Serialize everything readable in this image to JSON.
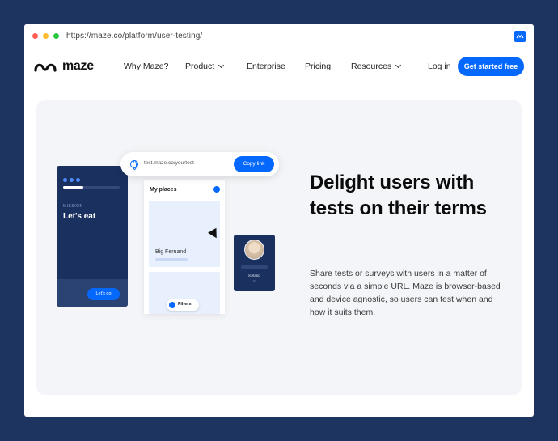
{
  "browser": {
    "url": "https://maze.co/platform/user-testing/",
    "extension_icon": "maze-extension-icon"
  },
  "nav": {
    "logo_text": "maze",
    "items": [
      {
        "label": "Why Maze?",
        "dropdown": false
      },
      {
        "label": "Product",
        "dropdown": true
      },
      {
        "label": "Enterprise",
        "dropdown": false
      },
      {
        "label": "Pricing",
        "dropdown": false
      },
      {
        "label": "Resources",
        "dropdown": true
      }
    ],
    "login_label": "Log in",
    "cta_label": "Get started free"
  },
  "hero": {
    "headline": "Delight users with tests on their terms",
    "description": "Share tests or surveys with users in a matter of seconds via a simple URL. Maze is browser-based and device agnostic, so users can test when and how it suits them."
  },
  "illustration": {
    "link_url": "test.maze.co/yourtest",
    "copy_label": "Copy link",
    "phone_mission": "MISSION",
    "phone_title": "Let's eat",
    "phone_button": "Let's go",
    "panel_title": "My places",
    "card_title": "Big Fernand",
    "filter_label": "Filters",
    "profile_name": "Iceland"
  },
  "colors": {
    "accent": "#0568fd",
    "navy": "#1a3160",
    "background": "#1d3461",
    "hero_bg": "#f4f5f8"
  }
}
